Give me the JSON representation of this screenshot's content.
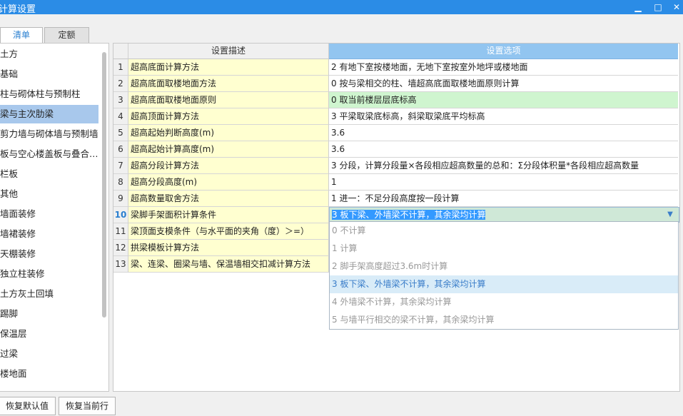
{
  "window": {
    "title": "计算设置",
    "minimize_icon": "minimize-icon",
    "maximize_icon": "maximize-icon",
    "close_icon": "close-icon",
    "minimize_glyph": "▁",
    "maximize_glyph": "□",
    "close_glyph": "✕"
  },
  "tabs": [
    {
      "label": "清单",
      "active": true
    },
    {
      "label": "定额",
      "active": false
    }
  ],
  "left_list": {
    "selected_index": 3,
    "items": [
      "土方",
      "基础",
      "柱与砌体柱与预制柱",
      "梁与主次肋梁",
      "剪力墙与砌体墙与预制墙",
      "板与空心楼盖板与叠合…",
      "栏板",
      "其他",
      "墙面装修",
      "墙裙装修",
      "天棚装修",
      "独立柱装修",
      "土方灰土回填",
      "踢脚",
      "保温层",
      "过梁",
      "楼地面"
    ]
  },
  "grid": {
    "headers": {
      "num": "",
      "description": "设置描述",
      "option": "设置选项"
    },
    "current_row": 10,
    "rows": [
      {
        "num": "1",
        "description": "超高底面计算方法",
        "option": "2 有地下室按楼地面，无地下室按室外地坪或楼地面"
      },
      {
        "num": "2",
        "description": "超高底面取楼地面方法",
        "option": "0 按与梁相交的柱、墙超高底面取楼地面原则计算"
      },
      {
        "num": "3",
        "description": "超高底面取楼地面原则",
        "option": "0 取当前楼层层底标高"
      },
      {
        "num": "4",
        "description": "超高顶面计算方法",
        "option": "3 平梁取梁底标高，斜梁取梁底平均标高"
      },
      {
        "num": "5",
        "description": "超高起始判断高度(m)",
        "option": "3.6"
      },
      {
        "num": "6",
        "description": "超高起始计算高度(m)",
        "option": "3.6"
      },
      {
        "num": "7",
        "description": "超高分段计算方法",
        "option": "3 分段，计算分段量×各段相应超高数量的总和：Σ分段体积量*各段相应超高数量"
      },
      {
        "num": "8",
        "description": "超高分段高度(m)",
        "option": "1"
      },
      {
        "num": "9",
        "description": "超高数量取舍方法",
        "option": "1 进一：不足分段高度按一段计算"
      },
      {
        "num": "10",
        "description": "梁脚手架面积计算条件",
        "option": "3 板下梁、外墙梁不计算，其余梁均计算"
      },
      {
        "num": "11",
        "description": "梁顶面支模条件（与水平面的夹角（度）＞=）",
        "option": ""
      },
      {
        "num": "12",
        "description": "拱梁模板计算方法",
        "option": ""
      },
      {
        "num": "13",
        "description": "梁、连梁、圈梁与墙、保温墙相交扣减计算方法",
        "option": ""
      }
    ]
  },
  "dropdown": {
    "arrow_glyph": "▼",
    "options": [
      "0 不计算",
      "1 计算",
      "2 脚手架高度超过3.6m时计算",
      "3 板下梁、外墙梁不计算，其余梁均计算",
      "4 外墙梁不计算，其余梁均计算",
      "5 与墙平行相交的梁不计算，其余梁均计算"
    ],
    "selected_index": 3
  },
  "buttons": {
    "restore_default": "恢复默认值",
    "restore_current": "恢复当前行"
  },
  "colors": {
    "titlebar": "#2b8ce6",
    "header_option_bg": "#92c5f0",
    "description_bg": "#ffffd0",
    "highlight_green": "#cff5cf",
    "left_selected": "#a8c8ec"
  }
}
